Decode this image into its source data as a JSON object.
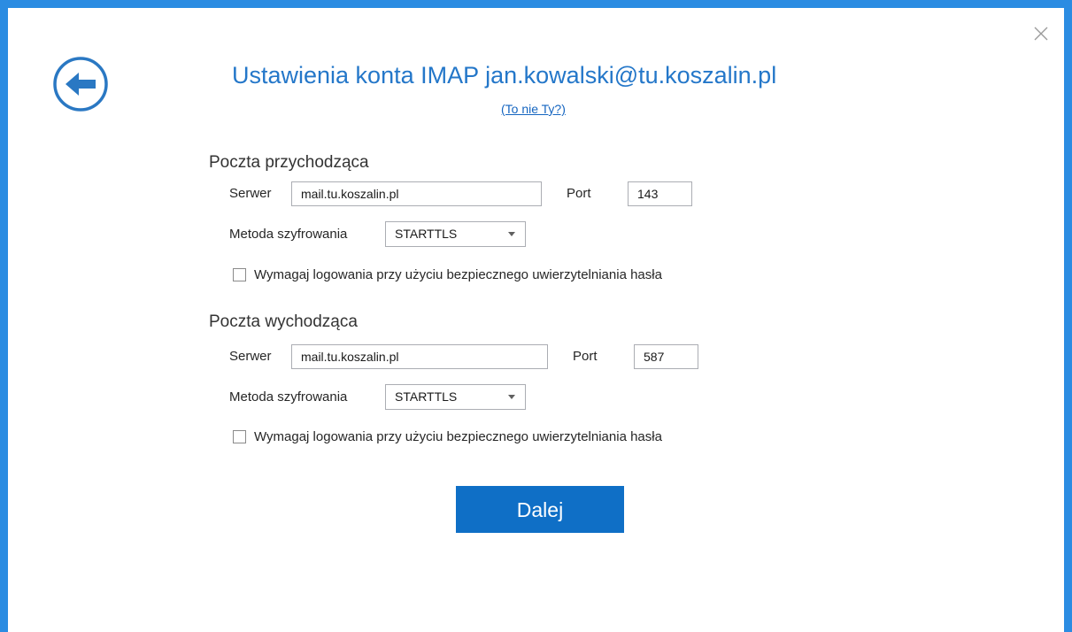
{
  "header": {
    "title": "Ustawienia konta IMAP jan.kowalski@tu.koszalin.pl",
    "not_you_link": "(To nie Ty?)",
    "back_icon": "back-arrow-icon",
    "close_icon": "close-icon"
  },
  "incoming": {
    "heading": "Poczta przychodząca",
    "server_label": "Serwer",
    "server_value": "mail.tu.koszalin.pl",
    "port_label": "Port",
    "port_value": "143",
    "encryption_label": "Metoda szyfrowania",
    "encryption_value": "STARTTLS",
    "spa_label": "Wymagaj logowania przy użyciu bezpiecznego uwierzytelniania hasła",
    "spa_checked": false
  },
  "outgoing": {
    "heading": "Poczta wychodząca",
    "server_label": "Serwer",
    "server_value": "mail.tu.koszalin.pl",
    "port_label": "Port",
    "port_value": "587",
    "encryption_label": "Metoda szyfrowania",
    "encryption_value": "STARTTLS",
    "spa_label": "Wymagaj logowania przy użyciu bezpiecznego uwierzytelniania hasła",
    "spa_checked": false
  },
  "actions": {
    "next_label": "Dalej"
  },
  "colors": {
    "accent": "#2b8ce2",
    "title": "#2477c9",
    "button": "#0f6fc6"
  }
}
